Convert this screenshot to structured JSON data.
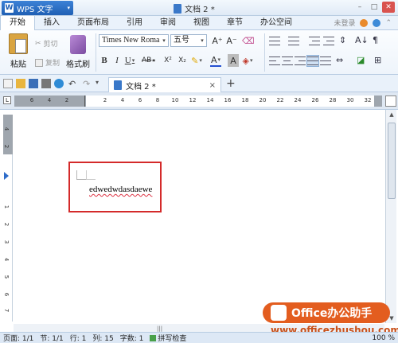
{
  "titlebar": {
    "app_name": "WPS 文字",
    "doc_title": "文档 2 *",
    "minimize": "–",
    "maximize": "□",
    "close": "✕"
  },
  "menu": {
    "tabs": [
      "开始",
      "插入",
      "页面布局",
      "引用",
      "审阅",
      "视图",
      "章节",
      "办公空间"
    ],
    "active": "开始",
    "login": "未登录"
  },
  "ribbon": {
    "paste_label": "粘贴",
    "cut_label": "剪切",
    "copy_label": "复制",
    "format_painter_label": "格式刷",
    "font_name": "Times New Roma",
    "font_size": "五号",
    "bold": "B",
    "italic": "I",
    "underline": "U",
    "strikethrough": "AB",
    "superscript": "X²",
    "subscript": "X₂",
    "font_color": "A",
    "char_shading": "A",
    "grow_font": "A⁺",
    "shrink_font": "A⁻"
  },
  "doc_tab": {
    "title": "文档 2 *",
    "close": "×",
    "new_tab": "+"
  },
  "ruler": {
    "marks": [
      "6",
      "4",
      "2",
      "2",
      "4",
      "6",
      "8",
      "10",
      "12",
      "14",
      "16",
      "18",
      "20",
      "22",
      "24",
      "26",
      "28",
      "30",
      "32"
    ]
  },
  "vruler": {
    "marks": [
      "4",
      "2",
      "1",
      "2",
      "3",
      "4",
      "5",
      "6",
      "7",
      "8"
    ]
  },
  "document": {
    "text": "edwedwdasdaewe"
  },
  "status": {
    "page": "页面: 1/1",
    "section": "节: 1/1",
    "line": "行: 1",
    "column": "列: 15",
    "words": "字数: 1",
    "spellcheck": "拼写检查",
    "zoom": "100 %"
  },
  "watermark": {
    "badge": "Office办公助手",
    "url": "www.officezhushou.com"
  }
}
